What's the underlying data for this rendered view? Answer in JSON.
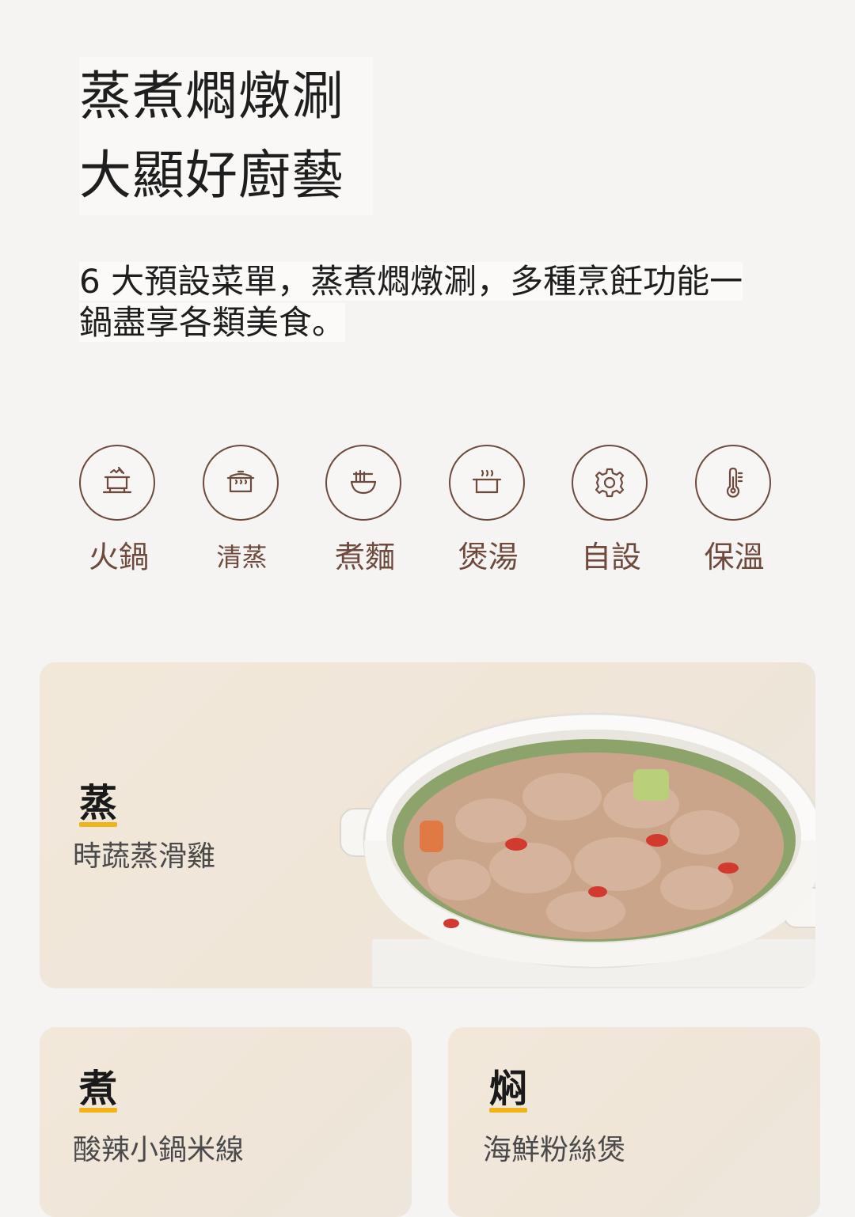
{
  "headline": {
    "line1": "蒸煮燜燉涮",
    "line2": "大顯好廚藝"
  },
  "description": "6 大預設菜單，蒸煮燜燉涮，多種烹飪功能一鍋盡享各類美食。",
  "modes": [
    {
      "label": "火鍋",
      "icon": "hotpot-icon"
    },
    {
      "label": "清蒸",
      "icon": "steam-pot-icon"
    },
    {
      "label": "煮麵",
      "icon": "noodle-bowl-icon"
    },
    {
      "label": "煲湯",
      "icon": "soup-pot-icon"
    },
    {
      "label": "自設",
      "icon": "gear-icon"
    },
    {
      "label": "保溫",
      "icon": "thermometer-icon"
    }
  ],
  "cards": {
    "steam": {
      "kanji": "蒸",
      "dish": "時蔬蒸滑雞"
    },
    "boil": {
      "kanji": "煮",
      "dish": "酸辣小鍋米線"
    },
    "braise": {
      "kanji": "焖",
      "dish": "海鮮粉絲煲"
    }
  },
  "colors": {
    "accent_brown": "#6e4a3d",
    "highlight_yellow": "#f0b31a",
    "card_bg": "#f0e6d9"
  }
}
